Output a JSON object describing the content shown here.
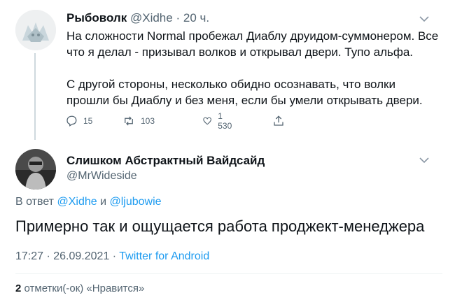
{
  "tweet1": {
    "author_name": "Рыбоволк",
    "author_handle": "@Xidhe",
    "separator": "·",
    "time_ago": "20 ч.",
    "text_lines": [
      "На сложности Normal пробежал Диаблу друидом-суммонером. Все",
      "что я делал - призывал волков и открывал двери. Тупо альфа.",
      "",
      "С другой стороны, несколько обидно осознавать, что волки",
      "прошли бы Диаблу и без меня, если бы умели открывать двери."
    ],
    "actions": {
      "replies": "15",
      "retweets": "103",
      "likes": "1 530"
    },
    "icons": [
      "avatar-wolf",
      "chevron-down-icon",
      "reply-icon",
      "retweet-icon",
      "like-icon",
      "share-icon"
    ]
  },
  "tweet2": {
    "author_name": "Слишком Абстрактный Вайдсайд",
    "author_handle": "@MrWideside",
    "reply_prefix": "В ответ",
    "reply_user1": "@Xidhe",
    "reply_conj": "и",
    "reply_user2": "@ljubowie",
    "text": "Примерно так и ощущается работа проджект-менеджера",
    "time": "17:27 · 26.09.2021 ·",
    "client": "Twitter for Android",
    "like_count": "2",
    "like_label": "отметки(-ок) «Нравится»"
  },
  "colors": {
    "accent": "#1d9bf0",
    "muted": "#536471",
    "text": "#0f1419",
    "thread_line": "#cfd9de"
  }
}
